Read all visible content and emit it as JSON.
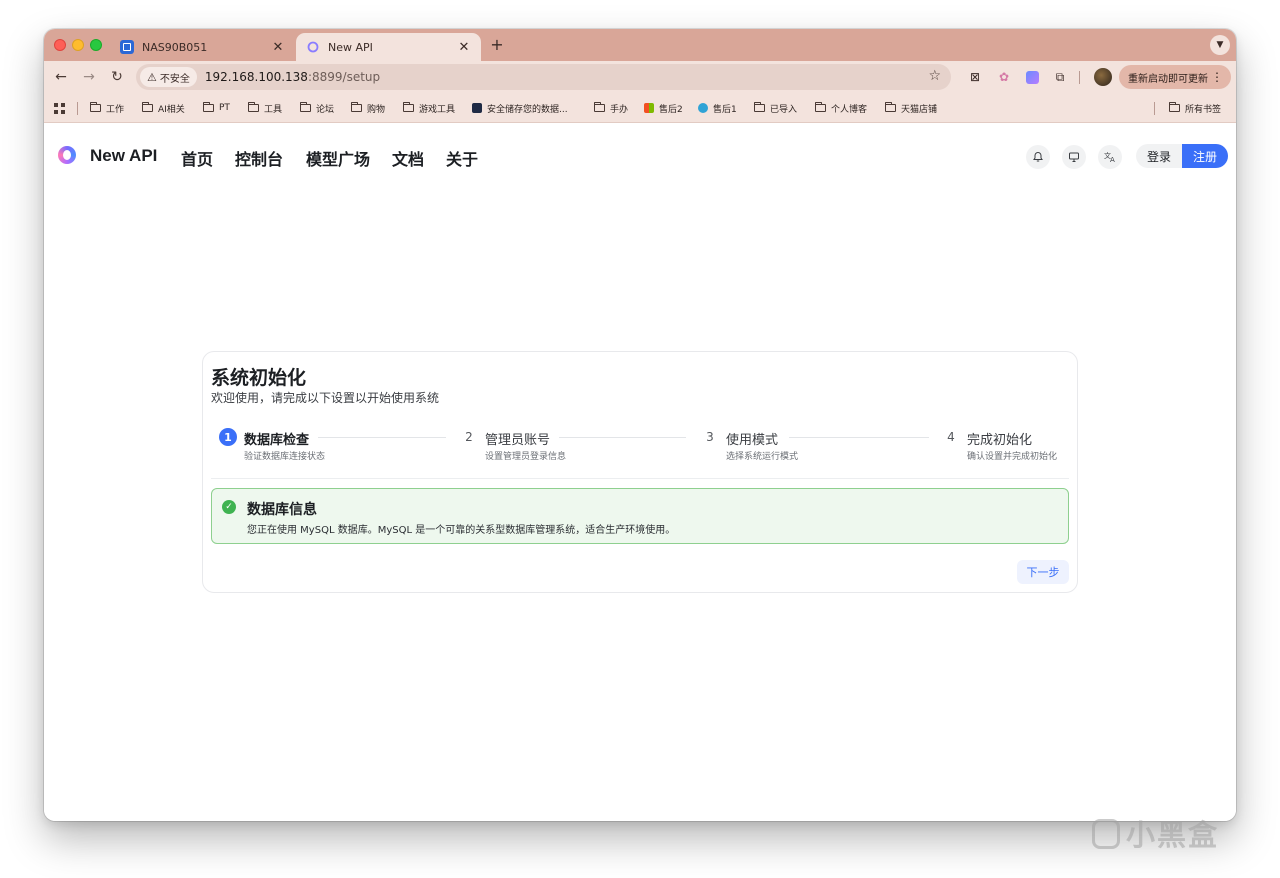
{
  "browser": {
    "tabs": [
      {
        "title": "NAS90B051",
        "favicon": "nas-icon"
      },
      {
        "title": "New API",
        "favicon": "new-api-logo",
        "active": true
      }
    ],
    "url": {
      "security_label": "不安全",
      "host": "192.168.100.138",
      "path": ":8899/setup"
    },
    "update_button": "重新启动即可更新",
    "bookmarks": [
      "工作",
      "AI相关",
      "PT",
      "工具",
      "论坛",
      "购物",
      "游戏工具",
      "安全储存您的数据...",
      "手办",
      "售后2",
      "售后1",
      "已导入",
      "个人博客",
      "天猫店铺"
    ],
    "all_bookmarks": "所有书签"
  },
  "site": {
    "brand": "New API",
    "nav": [
      "首页",
      "控制台",
      "模型广场",
      "文档",
      "关于"
    ],
    "login": "登录",
    "register": "注册",
    "accent_color": "#3a6ff8"
  },
  "setup": {
    "title": "系统初始化",
    "subtitle": "欢迎使用，请完成以下设置以开始使用系统",
    "steps": [
      {
        "num": "1",
        "label": "数据库检查",
        "desc": "验证数据库连接状态",
        "active": true
      },
      {
        "num": "2",
        "label": "管理员账号",
        "desc": "设置管理员登录信息"
      },
      {
        "num": "3",
        "label": "使用模式",
        "desc": "选择系统运行模式"
      },
      {
        "num": "4",
        "label": "完成初始化",
        "desc": "确认设置并完成初始化"
      }
    ],
    "info": {
      "title": "数据库信息",
      "text": "您正在使用 MySQL 数据库。MySQL 是一个可靠的关系型数据库管理系统，适合生产环境使用。"
    },
    "next_button": "下一步"
  },
  "watermark": "小黑盒"
}
